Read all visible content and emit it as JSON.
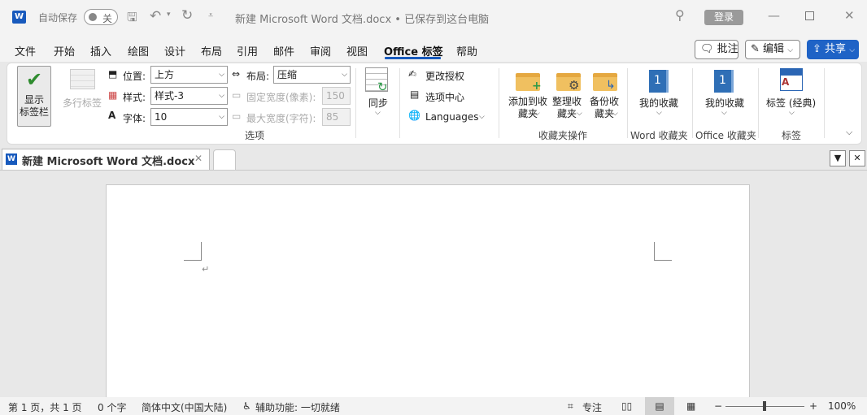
{
  "titlebar": {
    "autosave_label": "自动保存",
    "autosave_state": "关",
    "doc_title": "新建 Microsoft Word 文档.docx • 已保存到这台电脑",
    "login_label": "登录",
    "icons": [
      "word-logo-icon",
      "save-icon",
      "undo-icon",
      "redo-icon",
      "customize-icon",
      "search-icon",
      "minimize-icon",
      "maximize-icon",
      "close-icon"
    ]
  },
  "menu": {
    "items": [
      "文件",
      "开始",
      "插入",
      "绘图",
      "设计",
      "布局",
      "引用",
      "邮件",
      "审阅",
      "视图",
      "Office 标签",
      "帮助"
    ],
    "active": "Office 标签",
    "comment_label": "批注",
    "edit_label": "编辑",
    "share_label": "共享",
    "accent_color": "#185abd"
  },
  "ribbon": {
    "show_tabbar_label": "显示\n标签栏",
    "multirow_label": "多行标签",
    "position_label": "位置:",
    "position_value": "上方",
    "style_label": "样式:",
    "style_value": "样式-3",
    "font_label": "字体:",
    "font_value": "10",
    "layout_label": "布局:",
    "layout_value": "压缩",
    "fixed_width_label": "固定宽度(像素):",
    "fixed_width_value": "150",
    "max_width_label": "最大宽度(字符):",
    "max_width_value": "85",
    "options_group": "选项",
    "sync_label": "同步",
    "change_license_label": "更改授权",
    "options_center_label": "选项中心",
    "languages_label": "Languages",
    "add_fav_label": "添加到收\n藏夹",
    "organize_fav_label": "整理收\n藏夹",
    "backup_fav_label": "备份收\n藏夹",
    "fav_ops_group": "收藏夹操作",
    "my_fav_word": "我的收藏",
    "word_fav_group": "Word 收藏夹",
    "my_fav_office": "我的收藏",
    "office_fav_group": "Office 收藏夹",
    "tabs_classic_label": "标签 (经典)",
    "tabs_group": "标签"
  },
  "doctabs": {
    "active_tab": "新建 Microsoft Word 文档.docx",
    "close_symbol": "✕"
  },
  "statusbar": {
    "page": "第 1 页，共 1 页",
    "words": "0 个字",
    "language": "简体中文(中国大陆)",
    "accessibility": "辅助功能: 一切就绪",
    "focus": "专注",
    "zoom_minus": "−",
    "zoom_plus": "+",
    "zoom": "100%"
  }
}
